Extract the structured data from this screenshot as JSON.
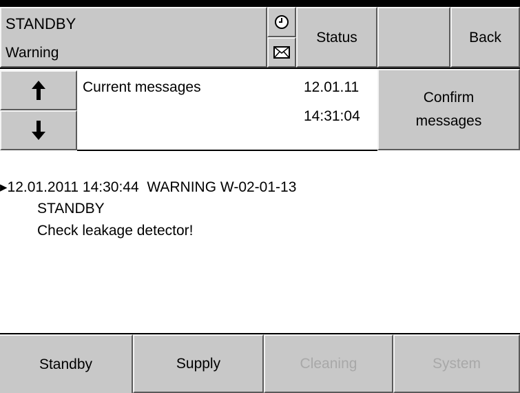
{
  "header": {
    "mode": "STANDBY",
    "state": "Warning",
    "status_label": "Status",
    "back_label": "Back",
    "clock_icon": "clock-icon",
    "mail_icon": "envelope-icon"
  },
  "messages_bar": {
    "title": "Current messages",
    "date": "12.01.11",
    "time": "14:31:04",
    "confirm_label": "Confirm\nmessages",
    "up_icon": "arrow-up-icon",
    "down_icon": "arrow-down-icon"
  },
  "message": {
    "line1": "▸12.01.2011 14:30:44  WARNING W-02-01-13",
    "line2": "STANDBY",
    "line3": "Check leakage detector!"
  },
  "nav": {
    "tabs": [
      {
        "label": "Standby",
        "enabled": true
      },
      {
        "label": "Supply",
        "enabled": true
      },
      {
        "label": "Cleaning",
        "enabled": false
      },
      {
        "label": "System",
        "enabled": false
      }
    ]
  }
}
